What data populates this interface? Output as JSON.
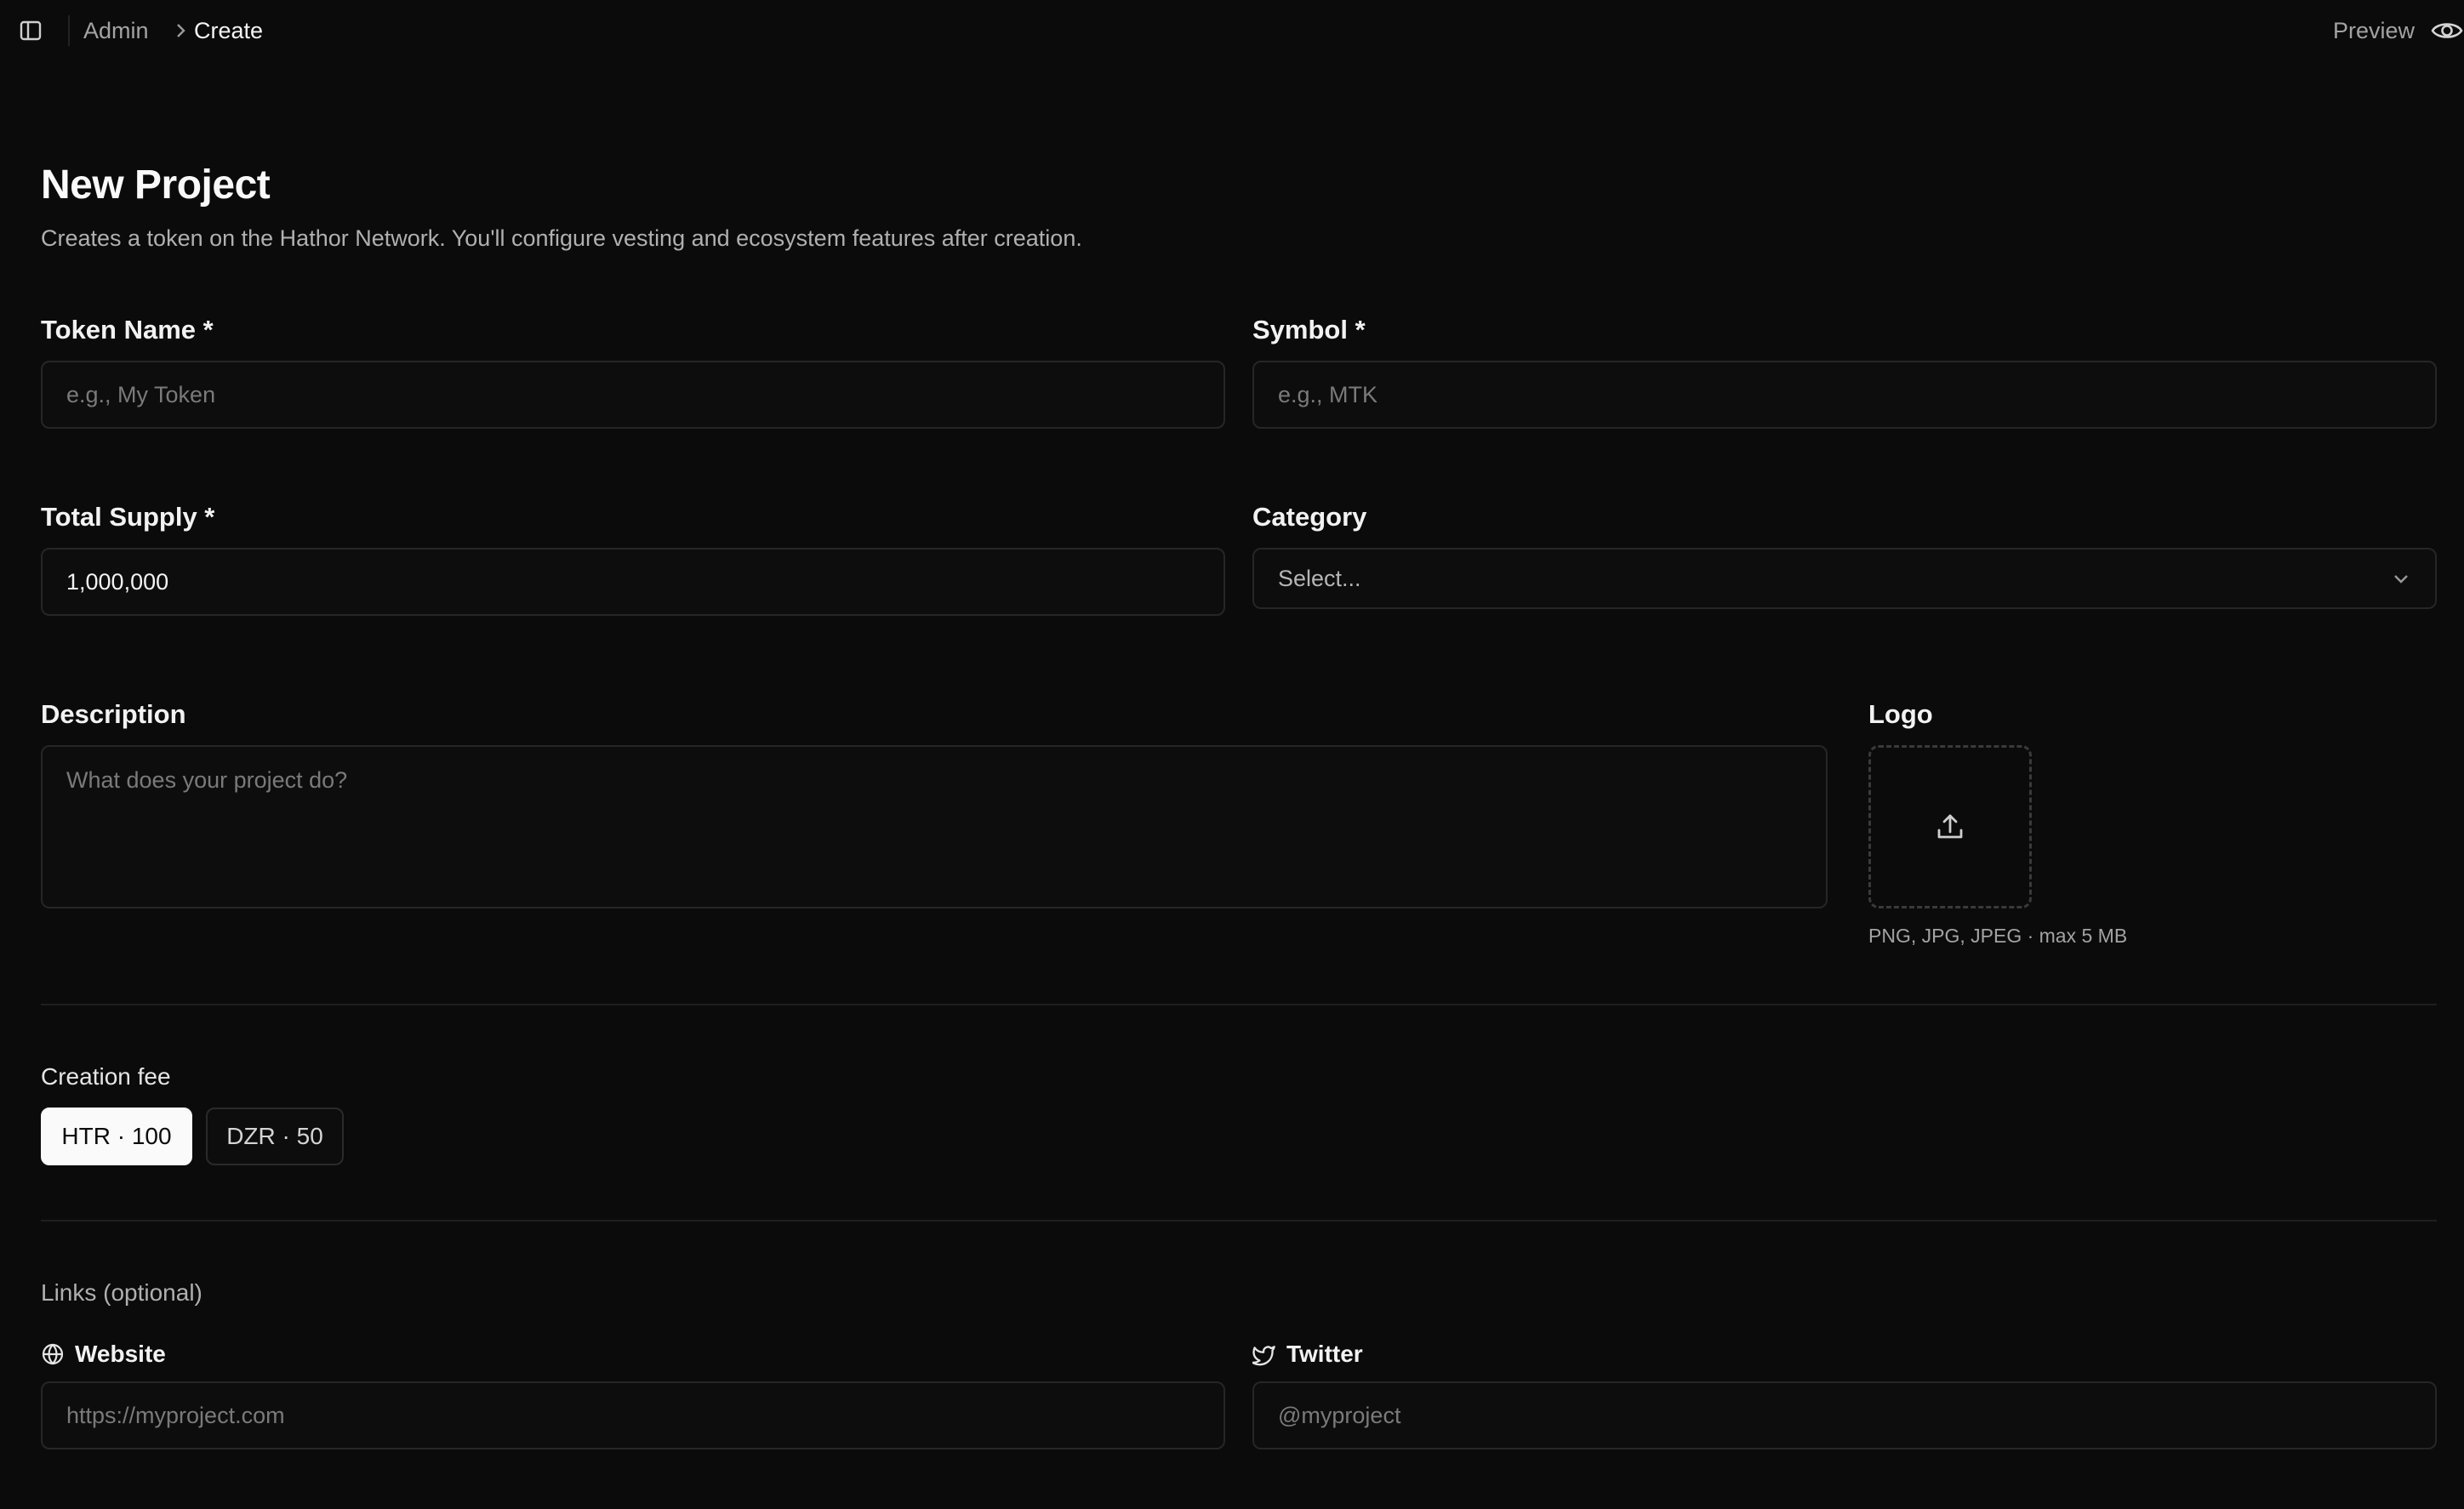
{
  "header": {
    "breadcrumb": [
      "Admin",
      "Create"
    ],
    "preview_label": "Preview"
  },
  "page": {
    "title": "New Project",
    "subtitle": "Creates a token on the Hathor Network. You'll configure vesting and ecosystem features after creation."
  },
  "form": {
    "token_name": {
      "label": "Token Name *",
      "placeholder": "e.g., My Token",
      "value": ""
    },
    "symbol": {
      "label": "Symbol *",
      "placeholder": "e.g., MTK",
      "value": ""
    },
    "total_supply": {
      "label": "Total Supply *",
      "value": "1,000,000"
    },
    "category": {
      "label": "Category",
      "selected": "Select..."
    },
    "description": {
      "label": "Description",
      "placeholder": "What does your project do?"
    },
    "logo": {
      "label": "Logo",
      "hint": "PNG, JPG, JPEG · max 5 MB"
    }
  },
  "fee": {
    "label": "Creation fee",
    "options": [
      {
        "label": "HTR · 100",
        "selected": true
      },
      {
        "label": "DZR · 50",
        "selected": false
      }
    ]
  },
  "links": {
    "label": "Links (optional)",
    "website": {
      "label": "Website",
      "placeholder": "https://myproject.com"
    },
    "twitter": {
      "label": "Twitter",
      "placeholder": "@myproject"
    }
  },
  "icons": {
    "sidebar": "sidebar-toggle-icon",
    "breadcrumb_separator": "chevron-right-icon",
    "preview": "eye-icon",
    "select": "chevron-down-icon",
    "upload": "upload-icon",
    "website": "globe-icon",
    "twitter": "twitter-icon"
  },
  "colors": {
    "background": "#0b0b0b",
    "border": "#262626",
    "text_primary": "#f2f2f2",
    "text_muted": "#a3a3a3",
    "active_button_bg": "#fafafa"
  }
}
